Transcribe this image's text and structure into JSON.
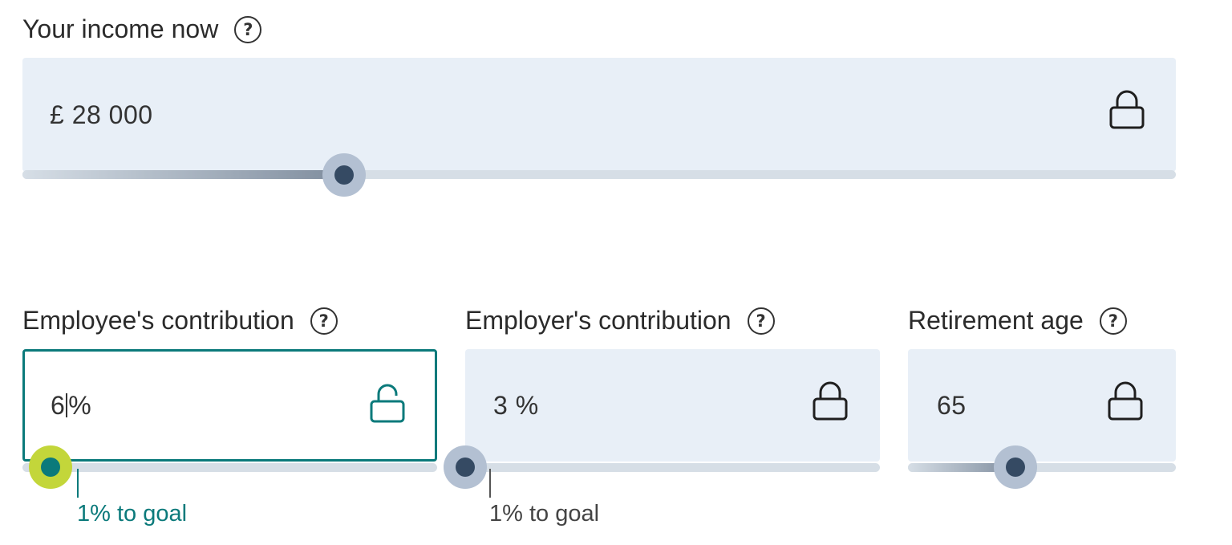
{
  "income": {
    "label": "Your income now",
    "value": "£ 28 000",
    "slider_fraction": 0.27
  },
  "employee": {
    "label": "Employee's contribution",
    "value": "6",
    "unit": "%",
    "goal_text": "1% to goal",
    "slider_fraction": 0.06
  },
  "employer": {
    "label": "Employer's contribution",
    "value": "3 %",
    "goal_text": "1% to goal",
    "slider_fraction": 0.0
  },
  "retirement": {
    "label": "Retirement age",
    "value": "65",
    "slider_fraction": 0.4
  },
  "icons": {
    "help": "help-circle-icon",
    "locked": "lock-closed-icon",
    "unlocked": "lock-open-icon"
  },
  "colors": {
    "teal_accent": "#0b7a7b",
    "lime_thumb": "#c3d63a",
    "field_bg": "#e8eff7",
    "thumb_dark": "#354a63"
  }
}
